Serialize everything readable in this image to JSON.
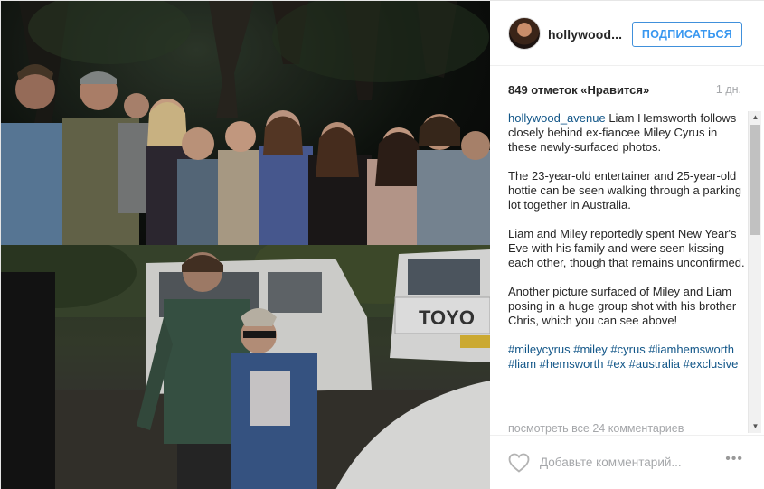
{
  "post": {
    "username": "hollywood...",
    "follow_label": "ПОДПИСАТЬСЯ",
    "likes": "849 отметок «Нравится»",
    "time": "1 дн.",
    "caption_user": "hollywood_avenue",
    "caption_lead": " Liam Hemsworth follows closely behind ex-fiancee Miley Cyrus in these newly-surfaced photos.",
    "paragraphs": [
      "The 23-year-old entertainer and 25-year-old hottie can be seen walking through a parking lot together in Australia.",
      "Liam and Miley reportedly spent New Year's Eve with his family and were seen kissing each other, though that remains unconfirmed.",
      "Another picture surfaced of Miley and Liam posing in a huge group shot with his brother Chris, which you can see above!"
    ],
    "hashtags": "#mileycyrus #miley #cyrus #liamhemsworth #liam #hemsworth #ex #australia #exclusive",
    "view_all": "посмотреть все 24 комментариев",
    "comment_placeholder": "Добавьте комментарий...",
    "more": "•••"
  },
  "photo": {
    "truck_text": "TOYO"
  },
  "icons": {
    "heart": "heart-icon",
    "more": "more-options-icon",
    "scroll_up": "scroll-up-arrow-icon",
    "scroll_down": "scroll-down-arrow-icon"
  },
  "colors": {
    "link": "#125688",
    "follow": "#3897f0",
    "muted": "#a5a7aa"
  }
}
